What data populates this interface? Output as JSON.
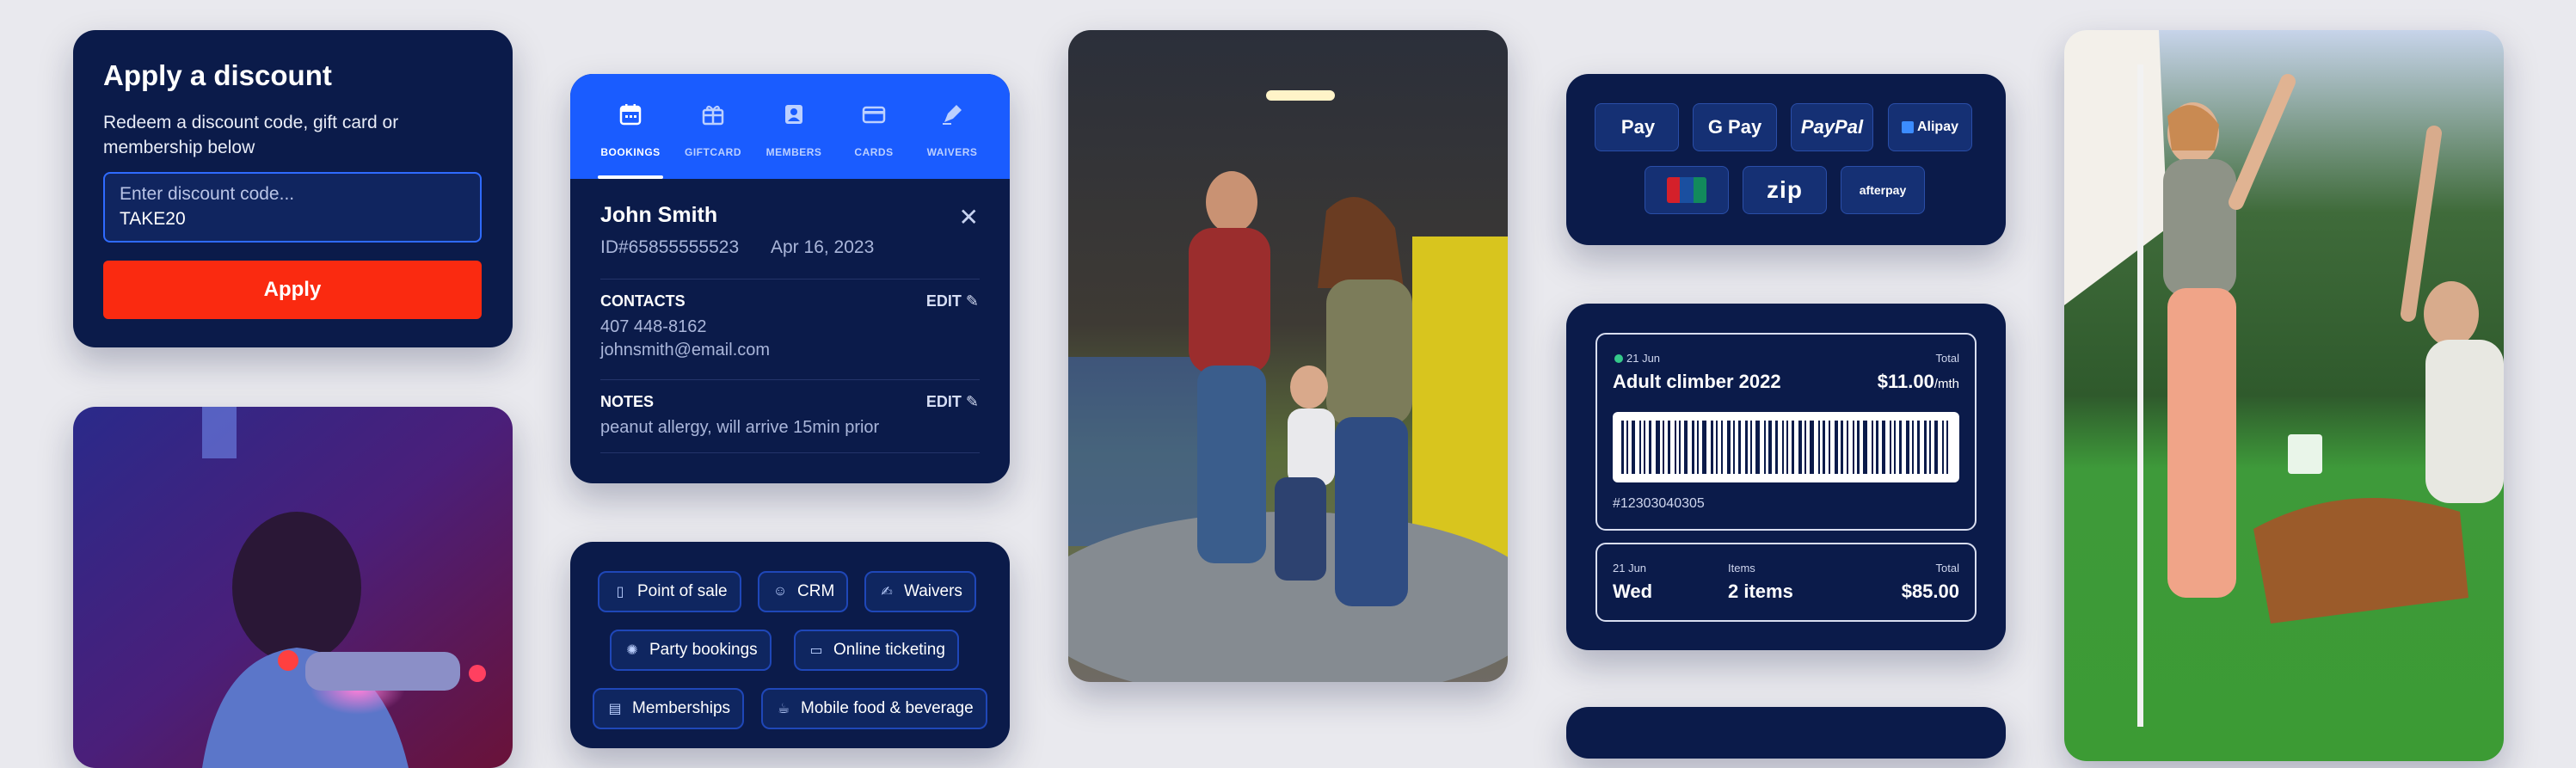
{
  "discount": {
    "title": "Apply a discount",
    "subtitle": "Redeem a discount code, gift card or membership below",
    "placeholder": "Enter discount code...",
    "value": "TAKE20",
    "button": "Apply",
    "button_color": "#fa2a10"
  },
  "booking": {
    "tabs": [
      {
        "label": "BOOKINGS",
        "icon": "calendar-icon",
        "active": true
      },
      {
        "label": "GIFTCARD",
        "icon": "gift-icon",
        "active": false
      },
      {
        "label": "MEMBERS",
        "icon": "member-badge-icon",
        "active": false
      },
      {
        "label": "CARDS",
        "icon": "credit-card-icon",
        "active": false
      },
      {
        "label": "WAIVERS",
        "icon": "pen-icon",
        "active": false
      }
    ],
    "name": "John Smith",
    "id": "ID#65855555523",
    "date": "Apr 16, 2023",
    "contacts_heading": "CONTACTS",
    "edit_label": "EDIT",
    "phone": "407 448-8162",
    "email": "johnsmith@email.com",
    "notes_heading": "NOTES",
    "notes": "peanut allergy, will arrive 15min prior",
    "accent": "#1a5cff"
  },
  "features": [
    {
      "label": "Point of sale",
      "icon": "pos-terminal-icon"
    },
    {
      "label": "CRM",
      "icon": "people-icon"
    },
    {
      "label": "Waivers",
      "icon": "document-sign-icon"
    },
    {
      "label": "Party bookings",
      "icon": "party-icon"
    },
    {
      "label": "Online ticketing",
      "icon": "ticket-icon"
    },
    {
      "label": "Memberships",
      "icon": "id-card-icon"
    },
    {
      "label": "Mobile food & beverage",
      "icon": "food-drink-icon"
    }
  ],
  "payments": [
    {
      "label": "Pay",
      "icon": "apple-icon"
    },
    {
      "label": "G Pay",
      "icon": "google-icon"
    },
    {
      "label": "PayPal",
      "icon": "paypal-logo"
    },
    {
      "label": "Alipay",
      "icon": "alipay-logo"
    },
    {
      "label": "UnionPay",
      "icon": "unionpay-logo"
    },
    {
      "label": "zip",
      "icon": "zip-logo"
    },
    {
      "label": "afterpay",
      "icon": "afterpay-logo"
    }
  ],
  "ticket": {
    "date": "21 Jun",
    "total_label": "Total",
    "product": "Adult climber 2022",
    "price": "$11.00",
    "price_unit": "/mth",
    "barcode_number": "#12303040305",
    "summary_date": "21 Jun",
    "summary_day": "Wed",
    "items_label": "Items",
    "items_value": "2 items",
    "summary_total_label": "Total",
    "summary_total": "$85.00",
    "status_dot_color": "#35c98a"
  }
}
